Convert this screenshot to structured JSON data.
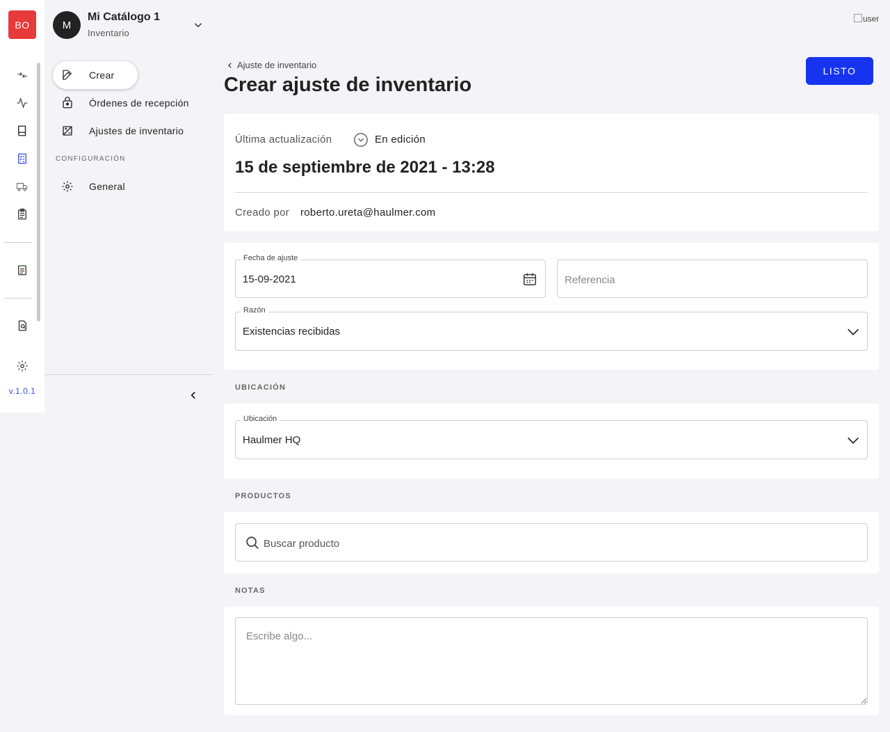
{
  "rail": {
    "logo": "BO",
    "version": "v.1.0.1",
    "icons": [
      "transfer-icon",
      "activity-icon",
      "book-icon",
      "checklist-icon",
      "truck-icon",
      "clipboard-icon",
      "report-icon",
      "document-search-icon",
      "settings-icon"
    ]
  },
  "sidebar": {
    "avatar_letter": "M",
    "catalog_name": "Mi Catálogo 1",
    "module": "Inventario",
    "create_label": "Crear",
    "items": [
      {
        "label": "Órdenes de recepción"
      },
      {
        "label": "Ajustes de inventario"
      }
    ],
    "config_section": "CONFIGURACIÓN",
    "config_items": [
      {
        "label": "General"
      }
    ]
  },
  "header": {
    "breadcrumb": "Ajuste de inventario",
    "title": "Crear ajuste de inventario",
    "done_button": "LISTO",
    "user_image_alt": "user"
  },
  "summary": {
    "updated_label": "Última actualización",
    "status": "En edición",
    "date": "15 de septiembre de 2021 - 13:28",
    "created_by_label": "Creado por",
    "created_by": "roberto.ureta@haulmer.com"
  },
  "form": {
    "date_label": "Fecha de ajuste",
    "date_value": "15-09-2021",
    "reference_placeholder": "Referencia",
    "reason_label": "Razón",
    "reason_value": "Existencias recibidas"
  },
  "location": {
    "section": "UBICACIÓN",
    "label": "Ubicación",
    "value": "Haulmer HQ"
  },
  "products": {
    "section": "PRODUCTOS",
    "search_placeholder": "Buscar producto"
  },
  "notes": {
    "section": "NOTAS",
    "placeholder": "Escribe algo..."
  },
  "colors": {
    "primary": "#1634f0",
    "logo": "#e83a3a",
    "background": "#f4f4f8"
  }
}
